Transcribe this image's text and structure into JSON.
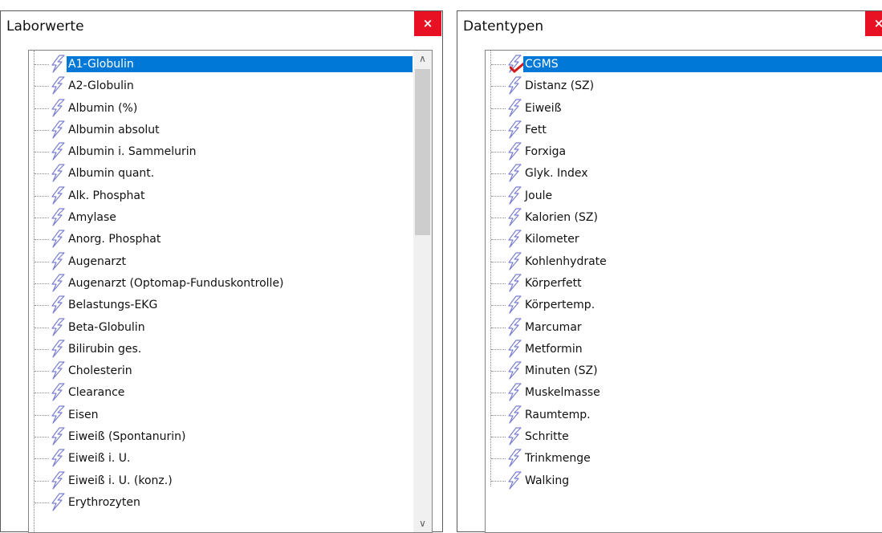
{
  "left_window": {
    "title": "Laborwerte",
    "close_label": "×",
    "selected_index": 0,
    "items": [
      "A1-Globulin",
      "A2-Globulin",
      "Albumin (%)",
      "Albumin absolut",
      "Albumin i. Sammelurin",
      "Albumin quant.",
      "Alk. Phosphat",
      "Amylase",
      "Anorg. Phosphat",
      "Augenarzt",
      "Augenarzt (Optomap-Funduskontrolle)",
      "Belastungs-EKG",
      "Beta-Globulin",
      "Bilirubin ges.",
      "Cholesterin",
      "Clearance",
      "Eisen",
      "Eiweiß (Spontanurin)",
      "Eiweiß i. U.",
      "Eiweiß i. U. (konz.)",
      "Erythrozyten"
    ],
    "scroll_up_glyph": "∧",
    "scroll_down_glyph": "∨"
  },
  "right_window": {
    "title": "Datentypen",
    "close_label": "×",
    "selected_index": 0,
    "checked_index": 0,
    "items": [
      "CGMS",
      "Distanz (SZ)",
      "Eiweiß",
      "Fett",
      "Forxiga",
      "Glyk. Index",
      "Joule",
      "Kalorien (SZ)",
      "Kilometer",
      "Kohlenhydrate",
      "Körperfett",
      "Körpertemp.",
      "Marcumar",
      "Metformin",
      "Minuten (SZ)",
      "Muskelmasse",
      "Raumtemp.",
      "Schritte",
      "Trinkmenge",
      "Walking"
    ]
  },
  "icons": {
    "item": "lightning-icon",
    "check": "check-icon",
    "close": "close-icon",
    "scroll_up": "chevron-up-icon",
    "scroll_down": "chevron-down-icon"
  },
  "colors": {
    "selection": "#0078d7",
    "close_button": "#e81123",
    "icon_stroke": "#7a7fd0",
    "check": "#d21919"
  }
}
